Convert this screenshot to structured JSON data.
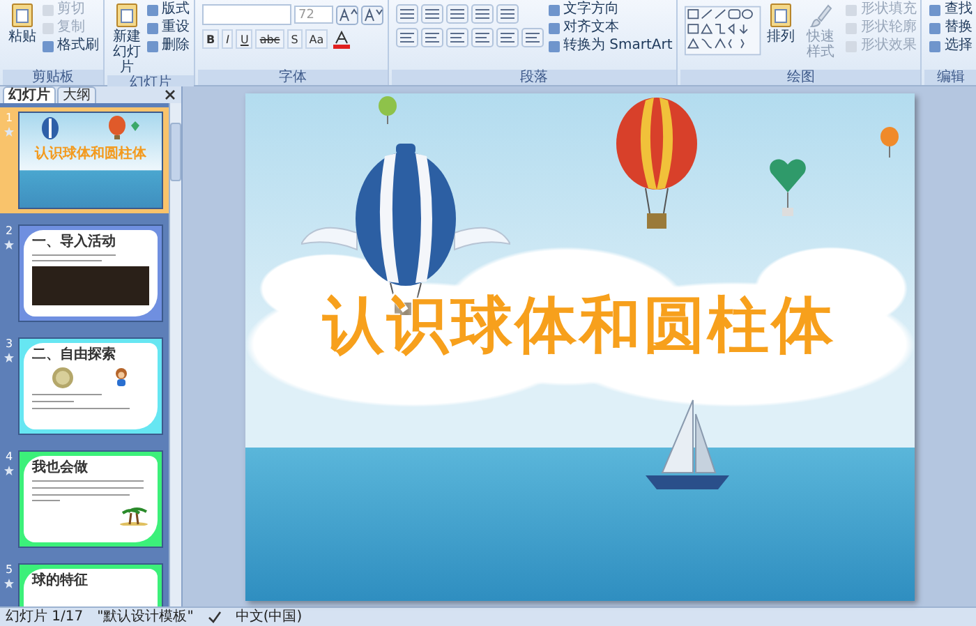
{
  "ribbon": {
    "groups": [
      {
        "label": "剪贴板",
        "kind": "clipboard",
        "large": [
          {
            "label": "粘贴",
            "disabled": false
          }
        ],
        "small": [
          {
            "label": "剪切",
            "disabled": true
          },
          {
            "label": "复制",
            "disabled": true
          },
          {
            "label": "格式刷",
            "disabled": false
          }
        ]
      },
      {
        "label": "幻灯片",
        "kind": "slides",
        "large": [
          {
            "label": "新建幻灯片",
            "disabled": false
          }
        ],
        "small": [
          {
            "label": "版式",
            "disabled": false
          },
          {
            "label": "重设",
            "disabled": false
          },
          {
            "label": "删除",
            "disabled": false
          }
        ]
      },
      {
        "label": "字体",
        "kind": "font",
        "font_size": "72",
        "format_buttons": [
          "B",
          "I",
          "U",
          "abc",
          "S",
          "Aa"
        ]
      },
      {
        "label": "段落",
        "kind": "paragraph",
        "small": [
          {
            "label": "文字方向",
            "disabled": false
          },
          {
            "label": "对齐文本",
            "disabled": false
          },
          {
            "label": "转换为 SmartArt",
            "disabled": false
          }
        ]
      },
      {
        "label": "绘图",
        "kind": "drawing",
        "large": [
          {
            "label": "排列",
            "disabled": false
          },
          {
            "label": "快速样式",
            "disabled": true
          }
        ],
        "small": [
          {
            "label": "形状填充",
            "disabled": true
          },
          {
            "label": "形状轮廓",
            "disabled": true
          },
          {
            "label": "形状效果",
            "disabled": true
          }
        ]
      },
      {
        "label": "编辑",
        "kind": "editing",
        "small": [
          {
            "label": "查找",
            "disabled": false
          },
          {
            "label": "替换",
            "disabled": false
          },
          {
            "label": "选择",
            "disabled": false
          }
        ]
      }
    ]
  },
  "panel_tabs": [
    {
      "label": "幻灯片",
      "selected": true
    },
    {
      "label": "大纲",
      "selected": false
    }
  ],
  "slides": [
    {
      "number": "1",
      "selected": true,
      "kind": "cover",
      "title": "认识球体和圆柱体"
    },
    {
      "number": "2",
      "selected": false,
      "kind": "photo",
      "title": "一、导入活动",
      "color": "#6f8fe0"
    },
    {
      "number": "3",
      "selected": false,
      "kind": "coin",
      "title": "二、自由探索",
      "color": "#66e6f2"
    },
    {
      "number": "4",
      "selected": false,
      "kind": "palm",
      "title": "我也会做",
      "color": "#3cf07a"
    },
    {
      "number": "5",
      "selected": false,
      "kind": "plain",
      "title": "球的特征",
      "color": "#3cf07a"
    }
  ],
  "main_slide": {
    "title": "认识球体和圆柱体"
  },
  "status_bar": {
    "slide_counter": "幻灯片 1/17",
    "theme": "\"默认设计模板\"",
    "language": "中文(中国)"
  }
}
